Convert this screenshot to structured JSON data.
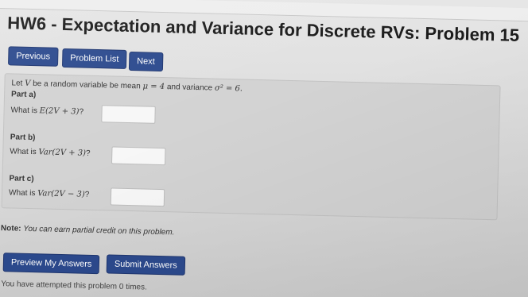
{
  "header": {
    "title": "HW6 - Expectation and Variance for Discrete RVs: Problem 15"
  },
  "nav": {
    "previous": "Previous",
    "problem_list": "Problem List",
    "next": "Next"
  },
  "problem": {
    "intro_text": "Let",
    "intro_var": "V",
    "intro_mid": "be a random variable be mean",
    "mean_expr": "μ = 4",
    "and_text": "and variance",
    "var_expr": "σ² = 6.",
    "parts": [
      {
        "label": "Part a)",
        "prompt": "What is",
        "expr": "E(2V + 3)",
        "q": "?",
        "value": ""
      },
      {
        "label": "Part b)",
        "prompt": "What is",
        "expr": "Var(2V + 3)",
        "q": "?",
        "value": ""
      },
      {
        "label": "Part c)",
        "prompt": "What is",
        "expr": "Var(2V − 3)",
        "q": "?",
        "value": ""
      }
    ]
  },
  "note": {
    "label": "Note:",
    "text": "You can earn partial credit on this problem."
  },
  "actions": {
    "preview": "Preview My Answers",
    "submit": "Submit Answers"
  },
  "footer": {
    "attempts_text": "You have attempted this problem 0 times."
  },
  "colors": {
    "button_bg": "#2c4a8e",
    "panel_bg": "#d3d3d3",
    "page_bg": "#dcdcdc"
  }
}
